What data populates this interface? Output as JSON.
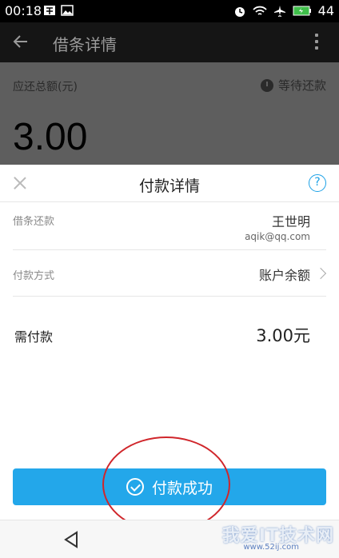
{
  "status_bar": {
    "time": "00:18",
    "battery": "44"
  },
  "app_header": {
    "title": "借条详情"
  },
  "summary": {
    "label": "应还总额(元)",
    "status": "等待还款",
    "amount": "3.00"
  },
  "sheet": {
    "title": "付款详情",
    "help": "?",
    "rows": [
      {
        "label": "借条还款",
        "value": "王世明",
        "sub": "aqik@qq.com"
      },
      {
        "label": "付款方式",
        "value": "账户余额"
      }
    ],
    "pay_label": "需付款",
    "pay_value": "3.00元",
    "button": "付款成功"
  },
  "watermark": {
    "text": "我爱IT技术网",
    "url": "www.52ij.com"
  },
  "colors": {
    "accent": "#23a7ea",
    "ring": "#d0262b"
  }
}
